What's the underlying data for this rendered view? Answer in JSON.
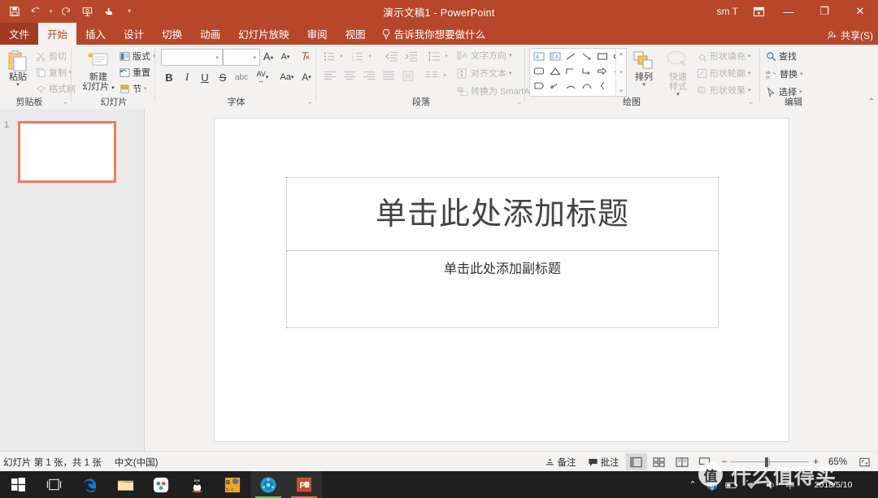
{
  "titlebar": {
    "document_title": "演示文稿1  -  PowerPoint",
    "qat": [
      {
        "name": "save",
        "icon": "save-icon"
      },
      {
        "name": "undo",
        "icon": "undo-icon"
      },
      {
        "name": "redo",
        "icon": "redo-icon"
      },
      {
        "name": "start-from-beginning",
        "icon": "slideshow-icon"
      },
      {
        "name": "touch-mouse-mode",
        "icon": "touch-mode-icon"
      },
      {
        "name": "customize-qat",
        "icon": "chevron-down-icon"
      }
    ],
    "user_label": "sm T",
    "ribbon_display_options": "ribbon-display-icon",
    "minimize": "—",
    "restore": "❐",
    "close": "✕"
  },
  "tabs": [
    {
      "id": "file",
      "label": "文件",
      "active": false
    },
    {
      "id": "home",
      "label": "开始",
      "active": true
    },
    {
      "id": "insert",
      "label": "插入",
      "active": false
    },
    {
      "id": "design",
      "label": "设计",
      "active": false
    },
    {
      "id": "transitions",
      "label": "切换",
      "active": false
    },
    {
      "id": "animations",
      "label": "动画",
      "active": false
    },
    {
      "id": "slideshow",
      "label": "幻灯片放映",
      "active": false
    },
    {
      "id": "review",
      "label": "审阅",
      "active": false
    },
    {
      "id": "view",
      "label": "视图",
      "active": false
    }
  ],
  "tellme": {
    "label": "告诉我你想要做什么",
    "icon": "lightbulb-icon"
  },
  "share": {
    "label": "共享(S)",
    "icon": "share-person-icon"
  },
  "ribbon": {
    "clipboard": {
      "group_label": "剪贴板",
      "paste": "粘贴",
      "cut": "剪切",
      "copy": "复制",
      "format_painter": "格式刷"
    },
    "slides": {
      "group_label": "幻灯片",
      "new_slide_line1": "新建",
      "new_slide_line2": "幻灯片",
      "layout": "版式",
      "reset": "重置",
      "section": "节"
    },
    "font": {
      "group_label": "字体",
      "font_name_value": "",
      "font_size_value": "",
      "grow_font": "A",
      "shrink_font": "A",
      "clear_formatting": "clear-format-icon",
      "bold": "B",
      "italic": "I",
      "underline": "U",
      "strikethrough": "S",
      "shadow": "abc",
      "char_spacing": "AV",
      "change_case": "Aa",
      "font_color": "A"
    },
    "paragraph": {
      "group_label": "段落",
      "bullets": "bullets-icon",
      "numbering": "numbering-icon",
      "decrease_indent": "decrease-indent-icon",
      "increase_indent": "increase-indent-icon",
      "line_spacing": "line-spacing-icon",
      "text_direction": "文字方向",
      "align_text": "对齐文本",
      "convert_smartart": "转换为 SmartArt",
      "align_left": "align-left-icon",
      "align_center": "align-center-icon",
      "align_right": "align-right-icon",
      "justify": "justify-icon",
      "columns": "columns-icon"
    },
    "drawing": {
      "group_label": "绘图",
      "arrange": "排列",
      "quick_styles_line1": "快速",
      "quick_styles_line2": "样式",
      "shape_fill": "形状填充",
      "shape_outline": "形状轮廓",
      "shape_effects": "形状效果"
    },
    "editing": {
      "group_label": "编辑",
      "find": "查找",
      "replace": "替换",
      "select": "选择"
    },
    "collapse_ribbon": "⌃"
  },
  "thumbnails": {
    "slides": [
      {
        "number": "1",
        "selected": true
      }
    ]
  },
  "slide": {
    "title_placeholder": "单击此处添加标题",
    "subtitle_placeholder": "单击此处添加副标题"
  },
  "statusbar": {
    "slide_count": "幻灯片 第 1 张，共 1 张",
    "language": "中文(中国)",
    "notes": "备注",
    "comments": "批注",
    "views": [
      {
        "name": "normal-view",
        "icon": "normal-view-icon",
        "active": true
      },
      {
        "name": "slide-sorter-view",
        "icon": "slide-sorter-icon",
        "active": false
      },
      {
        "name": "reading-view",
        "icon": "reading-view-icon",
        "active": false
      },
      {
        "name": "slideshow-view",
        "icon": "slideshow-view-icon",
        "active": false
      }
    ],
    "zoom_out": "−",
    "zoom_in": "+",
    "zoom_level": "65%",
    "fit_to_window": "fit-window-icon"
  },
  "taskbar": {
    "items": [
      {
        "name": "start-button",
        "icon": "windows-logo-icon"
      },
      {
        "name": "task-view-button",
        "icon": "task-view-icon"
      },
      {
        "name": "edge-browser",
        "icon": "edge-icon"
      },
      {
        "name": "file-explorer",
        "icon": "folder-icon"
      },
      {
        "name": "baidu-netdisk",
        "icon": "baidu-netdisk-icon"
      },
      {
        "name": "qq-messenger",
        "icon": "qq-penguin-icon"
      },
      {
        "name": "app-orange",
        "icon": "colorful-app-icon"
      },
      {
        "name": "media-player",
        "icon": "media-player-icon"
      },
      {
        "name": "powerpoint",
        "icon": "powerpoint-icon"
      }
    ],
    "tray": {
      "show_hidden": "⌃",
      "network": "network-icon",
      "battery": "battery-icon",
      "wifi": "wifi-icon",
      "volume": "volume-icon",
      "ime": "ime-icon"
    },
    "clock_date": "2018/5/10"
  },
  "watermark": {
    "badge": "值",
    "text": "什么值得买"
  }
}
